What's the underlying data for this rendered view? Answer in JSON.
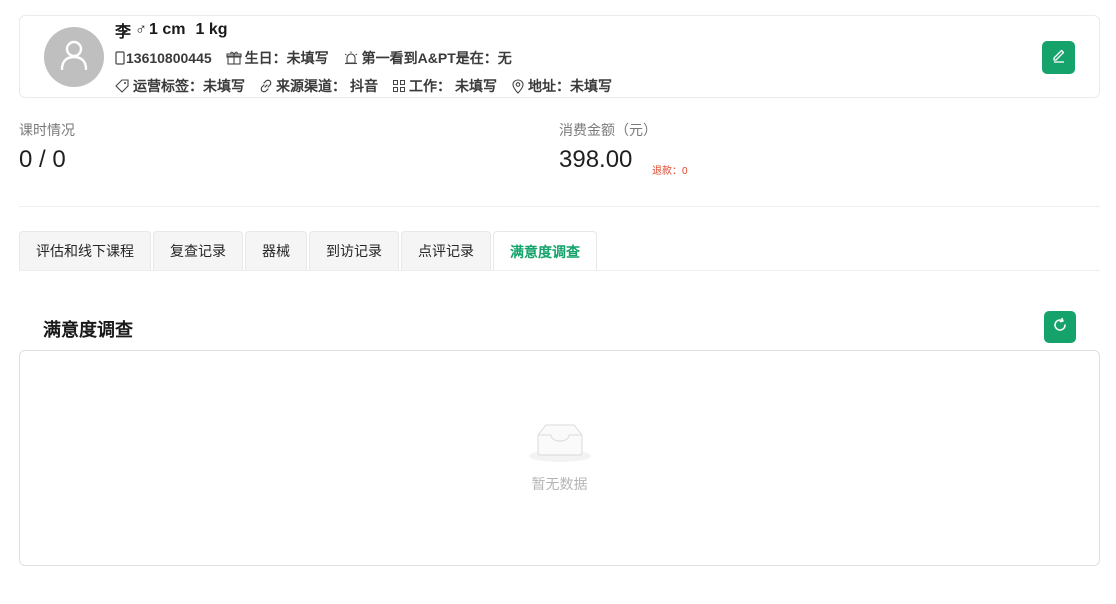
{
  "profile": {
    "name": "李",
    "gender_symbol": "♂",
    "height": "1 cm",
    "weight": "1 kg",
    "phone": "13610800445",
    "birthday_label": "生日：",
    "birthday_value": "未填写",
    "first_seen_label": "第一看到A&PT是在：",
    "first_seen_value": "无",
    "tags_label": "运营标签：",
    "tags_value": "未填写",
    "source_label": "来源渠道：",
    "source_value": "抖音",
    "job_label": "工作：",
    "job_value": "未填写",
    "address_label": "地址：",
    "address_value": "未填写"
  },
  "stats": {
    "hours_label": "课时情况",
    "hours_value": "0 / 0",
    "spend_label": "消费金额（元）",
    "spend_value": "398.00",
    "refund": "退款：0"
  },
  "tabs": [
    {
      "label": "评估和线下课程"
    },
    {
      "label": "复查记录"
    },
    {
      "label": "器械"
    },
    {
      "label": "到访记录"
    },
    {
      "label": "点评记录"
    },
    {
      "label": "满意度调查",
      "active": true
    }
  ],
  "section": {
    "title": "满意度调查",
    "empty_text": "暂无数据"
  },
  "colors": {
    "accent": "#15a36b",
    "refund": "#e0452b"
  },
  "icons": [
    "user-avatar-icon",
    "phone-icon",
    "gift-icon",
    "alarm-icon",
    "tag-icon",
    "link-icon",
    "grid-icon",
    "location-pin-icon",
    "edit-icon",
    "refresh-icon",
    "empty-inbox-icon"
  ]
}
